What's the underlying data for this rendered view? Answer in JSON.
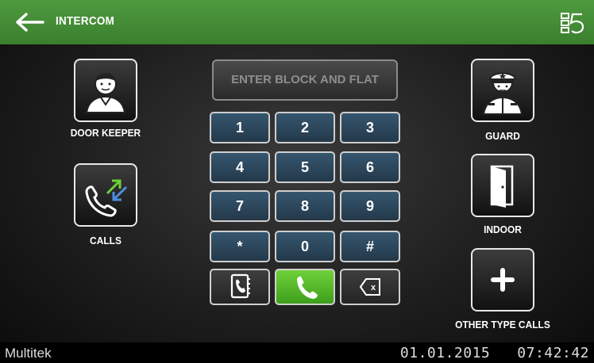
{
  "header": {
    "title": "INTERCOM",
    "back_icon": "arrow-left-icon",
    "logo_icon": "brand-logo-icon"
  },
  "display": {
    "placeholder": "ENTER BLOCK AND FLAT"
  },
  "left": {
    "door_keeper": {
      "label": "DOOR KEEPER",
      "icon": "door-keeper-person-icon"
    },
    "calls": {
      "label": "CALLS",
      "icon": "phone-calls-arrows-icon"
    }
  },
  "right": {
    "guard": {
      "label": "GUARD",
      "icon": "guard-person-icon"
    },
    "indoor": {
      "label": "INDOOR",
      "icon": "door-icon"
    },
    "other": {
      "label": "OTHER TYPE CALLS",
      "icon": "plus-icon"
    }
  },
  "keypad": {
    "keys": [
      "1",
      "2",
      "3",
      "4",
      "5",
      "6",
      "7",
      "8",
      "9",
      "*",
      "0",
      "#"
    ]
  },
  "actions": {
    "phonebook_icon": "phonebook-icon",
    "call_icon": "phone-icon",
    "backspace_icon": "backspace-icon",
    "backspace_mark": "x"
  },
  "footer": {
    "brand": "Multitek",
    "date": "01.01.2015",
    "time": "07:42:42"
  },
  "colors": {
    "header_green": "#4f9a3f",
    "call_green": "#5cbf2a",
    "key_blue": "#2e4a60"
  }
}
